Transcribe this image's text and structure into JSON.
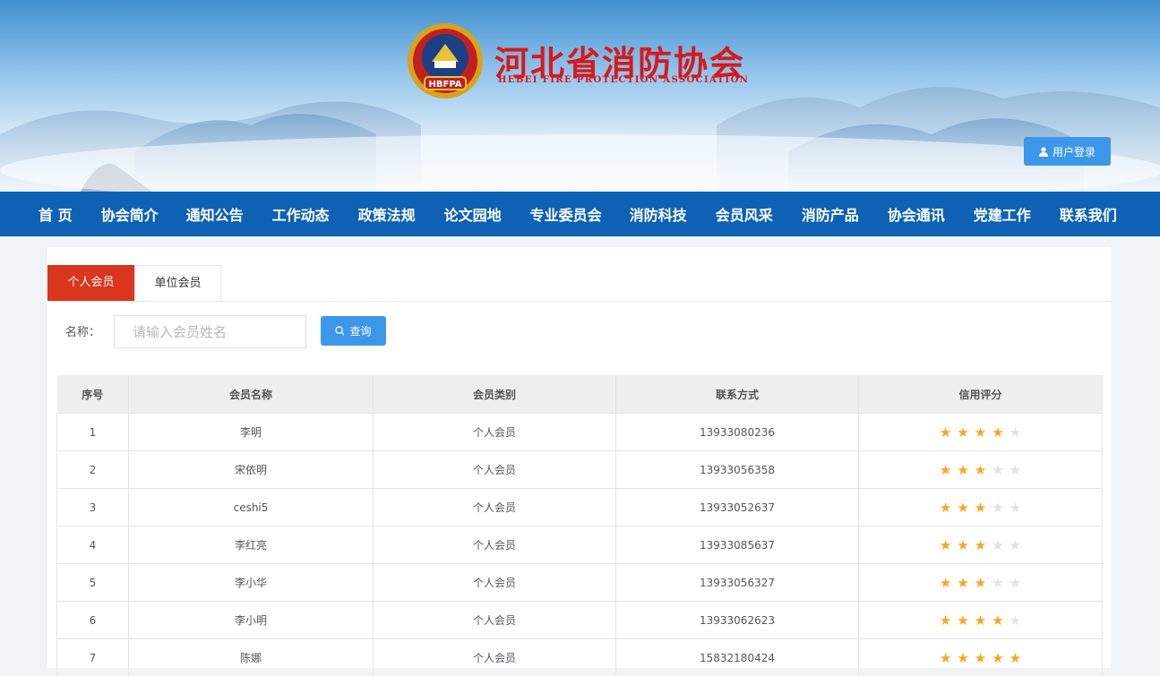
{
  "header": {
    "title": "河北省消防协会",
    "subtitle": "HEBEI FIRE PROTECTION ASSOCIATION",
    "logo_text": "HBFPA",
    "logo_ring_text": "河北省消防协会",
    "login_label": "用户登录",
    "login_icon": "user-icon"
  },
  "nav": {
    "items": [
      "首 页",
      "协会简介",
      "通知公告",
      "工作动态",
      "政策法规",
      "论文园地",
      "专业委员会",
      "消防科技",
      "会员风采",
      "消防产品",
      "协会通讯",
      "党建工作",
      "联系我们"
    ]
  },
  "tabs": [
    {
      "label": "个人会员",
      "active": true
    },
    {
      "label": "单位会员",
      "active": false
    }
  ],
  "search": {
    "label": "名称：",
    "placeholder": "请输入会员姓名",
    "value": "",
    "button_label": "查询",
    "button_icon": "search-icon"
  },
  "table": {
    "headers": [
      "序号",
      "会员名称",
      "会员类别",
      "联系方式",
      "信用评分"
    ],
    "rating_max": 5,
    "rows": [
      {
        "index": "1",
        "name": "李明",
        "category": "个人会员",
        "phone": "13933080236",
        "rating": 4
      },
      {
        "index": "2",
        "name": "宋依明",
        "category": "个人会员",
        "phone": "13933056358",
        "rating": 3
      },
      {
        "index": "3",
        "name": "ceshi5",
        "category": "个人会员",
        "phone": "13933052637",
        "rating": 3
      },
      {
        "index": "4",
        "name": "李红亮",
        "category": "个人会员",
        "phone": "13933085637",
        "rating": 3
      },
      {
        "index": "5",
        "name": "李小华",
        "category": "个人会员",
        "phone": "13933056327",
        "rating": 3
      },
      {
        "index": "6",
        "name": "李小明",
        "category": "个人会员",
        "phone": "13933062623",
        "rating": 4
      },
      {
        "index": "7",
        "name": "陈娜",
        "category": "个人会员",
        "phone": "15832180424",
        "rating": 5
      }
    ]
  },
  "colors": {
    "nav_bg": "#0f61b4",
    "tab_active": "#d9361d",
    "button_blue": "#3d97e8",
    "title_red": "#d71a1a",
    "star_on": "#f5a623",
    "star_off": "#e2e2e2"
  }
}
